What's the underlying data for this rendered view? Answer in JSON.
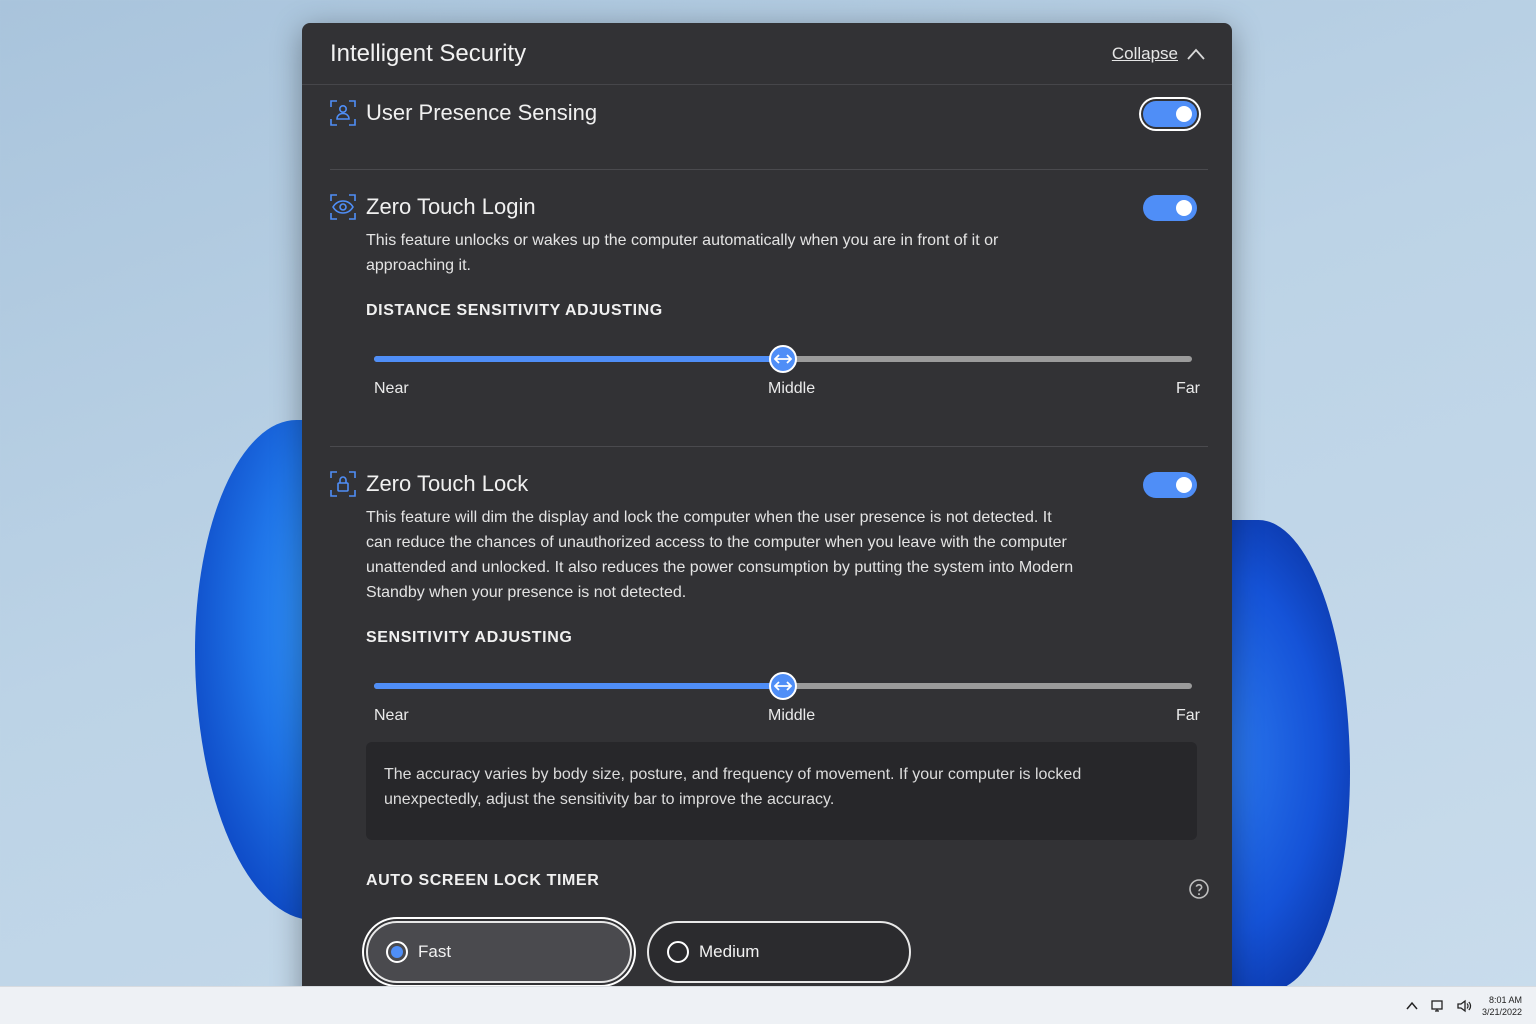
{
  "panel": {
    "title": "Intelligent Security",
    "collapse_label": "Collapse"
  },
  "user_presence": {
    "title": "User Presence Sensing",
    "enabled": true
  },
  "zero_touch_login": {
    "title": "Zero Touch Login",
    "enabled": true,
    "description": "This feature unlocks or wakes up the computer automatically when you are in front of it or approaching it.",
    "distance_heading": "DISTANCE SENSITIVITY ADJUSTING",
    "slider": {
      "value": 0.5,
      "near": "Near",
      "middle": "Middle",
      "far": "Far"
    }
  },
  "zero_touch_lock": {
    "title": "Zero Touch Lock",
    "enabled": true,
    "description": "This feature will dim the display and lock the computer when the user presence is not detected. It can reduce the chances of unauthorized access to the computer when you leave with the computer unattended and unlocked. It also reduces the power consumption by putting the system into Modern Standby when your presence is not detected.",
    "sensitivity_heading": "SENSITIVITY ADJUSTING",
    "slider": {
      "value": 0.5,
      "near": "Near",
      "middle": "Middle",
      "far": "Far"
    },
    "info": "The accuracy varies by body size, posture, and frequency of movement. If your computer is locked unexpectedly, adjust the sensitivity bar to improve the accuracy."
  },
  "auto_lock_timer": {
    "heading": "AUTO SCREEN LOCK TIMER",
    "options": [
      {
        "label": "Fast",
        "selected": true
      },
      {
        "label": "Medium",
        "selected": false
      }
    ]
  },
  "taskbar": {
    "time": "8:01 AM",
    "date": "3/21/2022"
  },
  "colors": {
    "accent": "#4f8ef7",
    "panel_bg": "#323235"
  }
}
